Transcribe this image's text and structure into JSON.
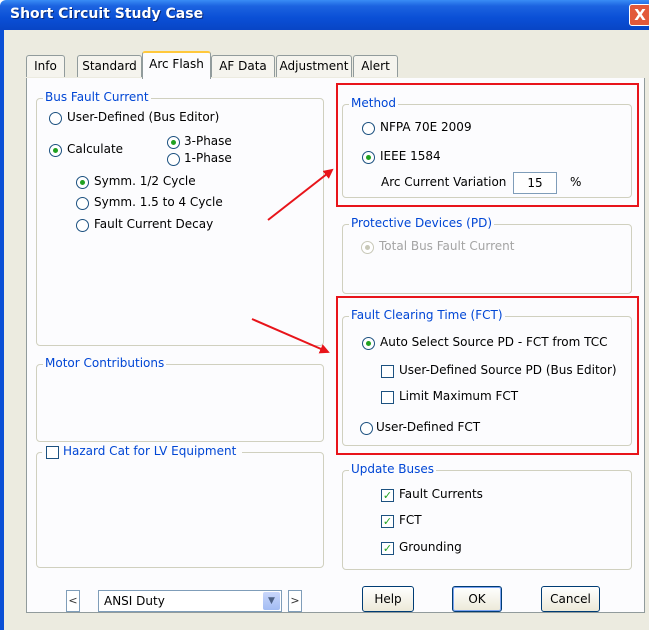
{
  "window": {
    "title": "Short Circuit Study Case",
    "close_label": "X"
  },
  "tabs": [
    {
      "label": "Info"
    },
    {
      "label": "Standard"
    },
    {
      "label": "Arc Flash"
    },
    {
      "label": "AF Data"
    },
    {
      "label": "Adjustment"
    },
    {
      "label": "Alert"
    }
  ],
  "active_tab": "Arc Flash",
  "bus_fault_current": {
    "title": "Bus Fault Current",
    "user_defined": "User-Defined (Bus Editor)",
    "calculate": "Calculate",
    "three_phase": "3-Phase",
    "one_phase": "1-Phase",
    "symm_half": "Symm. 1/2 Cycle",
    "symm_1_5": "Symm. 1.5 to 4 Cycle",
    "fault_decay": "Fault Current Decay"
  },
  "motor_contributions": {
    "title": "Motor Contributions"
  },
  "hazard_cat": {
    "title": "Hazard Cat for LV Equipment"
  },
  "method": {
    "title": "Method",
    "nfpa": "NFPA 70E 2009",
    "ieee": "IEEE 1584",
    "variation_label": "Arc Current Variation",
    "variation_value": "15",
    "variation_unit": "%"
  },
  "protective_devices": {
    "title": "Protective Devices (PD)",
    "total_bus": "Total Bus Fault Current"
  },
  "fct": {
    "title": "Fault Clearing Time (FCT)",
    "auto_select": "Auto Select Source PD - FCT from TCC",
    "user_source": "User-Defined Source PD (Bus Editor)",
    "limit_max": "Limit Maximum FCT",
    "user_fct": "User-Defined FCT"
  },
  "update_buses": {
    "title": "Update Buses",
    "fault_currents": "Fault Currents",
    "fct": "FCT",
    "grounding": "Grounding"
  },
  "footer": {
    "prev": "<",
    "next": ">",
    "duty_value": "ANSI Duty",
    "help": "Help",
    "ok": "OK",
    "cancel": "Cancel"
  },
  "colors": {
    "highlight": "#e8141a",
    "group_title": "#0046d5",
    "titlebar": "#0a4fd6"
  }
}
